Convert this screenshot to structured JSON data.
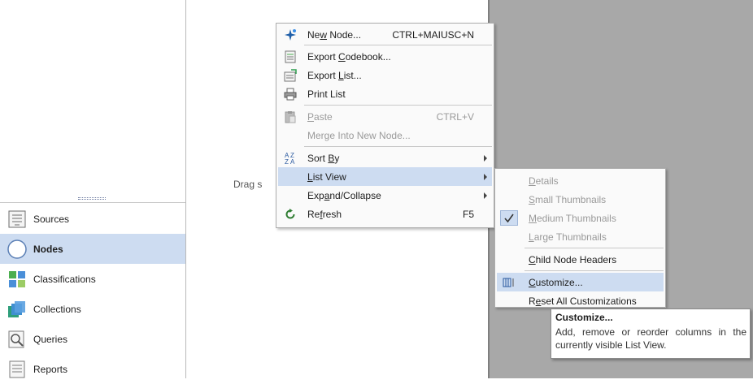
{
  "nav": {
    "items": [
      {
        "label": "Sources",
        "icon": "sources-icon"
      },
      {
        "label": "Nodes",
        "icon": "nodes-icon",
        "active": true
      },
      {
        "label": "Classifications",
        "icon": "classifications-icon"
      },
      {
        "label": "Collections",
        "icon": "collections-icon"
      },
      {
        "label": "Queries",
        "icon": "queries-icon"
      },
      {
        "label": "Reports",
        "icon": "reports-icon"
      }
    ]
  },
  "center": {
    "drag_text": "Drag s"
  },
  "menu": {
    "items": [
      {
        "label": "New Node...",
        "mnemonic": "w",
        "shortcut": "CTRL+MAIUSC+N",
        "icon": "new-node-icon"
      },
      {
        "label": "Export Codebook...",
        "icon": "export-codebook-icon"
      },
      {
        "label": "Export List...",
        "icon": "export-list-icon"
      },
      {
        "label": "Print List",
        "icon": "print-list-icon"
      },
      {
        "label": "Paste",
        "shortcut": "CTRL+V",
        "icon": "paste-icon",
        "disabled": true
      },
      {
        "label": "Merge Into New Node...",
        "disabled": true
      },
      {
        "label": "Sort By",
        "icon": "sort-az-icon",
        "submenu": true
      },
      {
        "label": "List View",
        "submenu": true,
        "highlighted": true
      },
      {
        "label": "Expand/Collapse",
        "submenu": true
      },
      {
        "label": "Refresh",
        "shortcut": "F5",
        "icon": "refresh-icon"
      }
    ]
  },
  "submenu": {
    "items": [
      {
        "label": "Details",
        "disabled": true
      },
      {
        "label": "Small Thumbnails",
        "disabled": true
      },
      {
        "label": "Medium Thumbnails",
        "disabled": true,
        "checked": true
      },
      {
        "label": "Large Thumbnails",
        "disabled": true
      },
      {
        "label": "Child Node Headers"
      },
      {
        "label": "Customize...",
        "icon": "customize-columns-icon",
        "highlighted": true
      },
      {
        "label": "Reset All Customizations"
      }
    ]
  },
  "tooltip": {
    "title": "Customize...",
    "body": "Add, remove or reorder columns in the currently visible List View."
  },
  "colors": {
    "highlight": "#cddcf1",
    "gray_pane": "#a8a8a8"
  }
}
